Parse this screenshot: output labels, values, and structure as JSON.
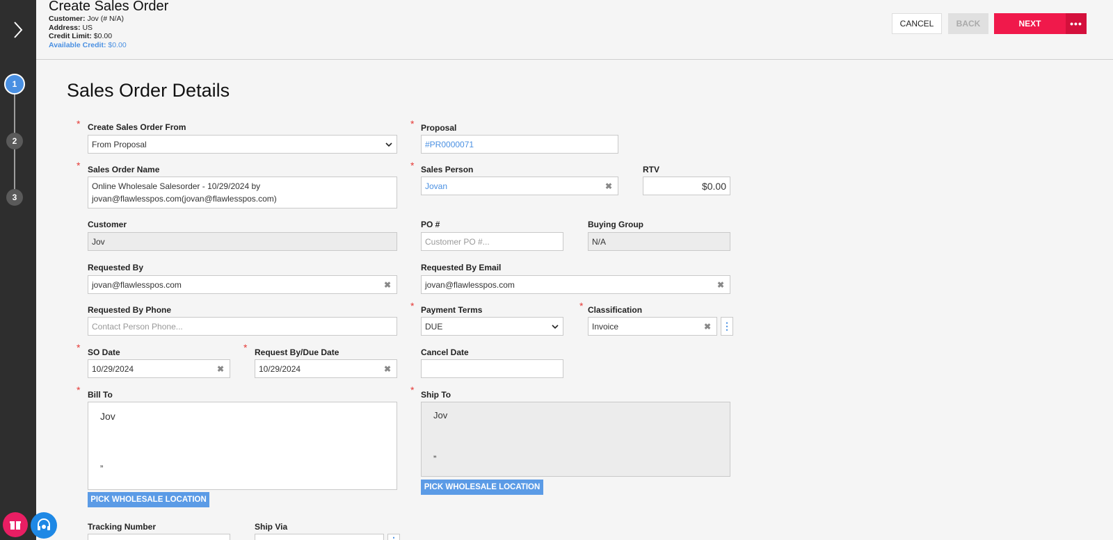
{
  "header": {
    "title": "Create Sales Order",
    "customer_label": "Customer:",
    "customer_value": "Jov (# N/A)",
    "address_label": "Address:",
    "address_value": "US",
    "credit_limit_label": "Credit Limit:",
    "credit_limit_value": "$0.00",
    "available_credit_label": "Available Credit:",
    "available_credit_value": "$0.00",
    "cancel_label": "CANCEL",
    "back_label": "BACK",
    "next_label": "NEXT",
    "more_label": "•••"
  },
  "steps": [
    "1",
    "2",
    "3"
  ],
  "form": {
    "title": "Sales Order Details",
    "create_from": {
      "label": "Create Sales Order From",
      "value": "From Proposal"
    },
    "proposal": {
      "label": "Proposal",
      "value": "#PR0000071"
    },
    "sales_order_name": {
      "label": "Sales Order Name",
      "value_line1": "Online Wholesale Salesorder - 10/29/2024 by",
      "value_line2": "jovan@flawlesspos.com(jovan@flawlesspos.com)"
    },
    "sales_person": {
      "label": "Sales Person",
      "value": "Jovan"
    },
    "rtv": {
      "label": "RTV",
      "value": "$0.00"
    },
    "customer": {
      "label": "Customer",
      "value": "Jov"
    },
    "po": {
      "label": "PO #",
      "placeholder": "Customer PO #..."
    },
    "buying_group": {
      "label": "Buying Group",
      "value": "N/A"
    },
    "requested_by": {
      "label": "Requested By",
      "value": "jovan@flawlesspos.com"
    },
    "requested_by_email": {
      "label": "Requested By Email",
      "value": "jovan@flawlesspos.com"
    },
    "requested_by_phone": {
      "label": "Requested By Phone",
      "placeholder": "Contact Person Phone..."
    },
    "payment_terms": {
      "label": "Payment Terms",
      "value": "DUE"
    },
    "classification": {
      "label": "Classification",
      "value": "Invoice"
    },
    "so_date": {
      "label": "SO Date",
      "value": "10/29/2024"
    },
    "request_by_date": {
      "label": "Request By/Due Date",
      "value": "10/29/2024"
    },
    "cancel_date": {
      "label": "Cancel Date",
      "value": ""
    },
    "bill_to": {
      "label": "Bill To",
      "name": "Jov",
      "line2": "„"
    },
    "ship_to": {
      "label": "Ship To",
      "name": "Jov",
      "line2": "„"
    },
    "pick_location_label": "PICK WHOLESALE LOCATION",
    "tracking_number": {
      "label": "Tracking Number"
    },
    "ship_via": {
      "label": "Ship Via"
    },
    "required_marker": "*",
    "clear_glyph": "✖"
  }
}
